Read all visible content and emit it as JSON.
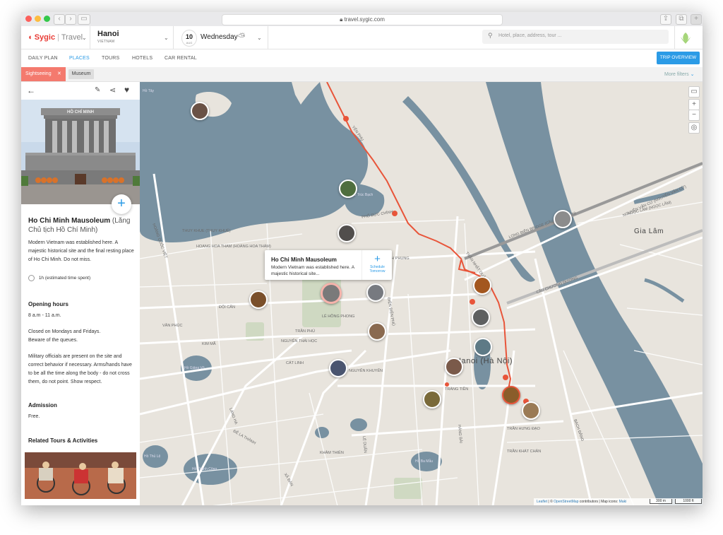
{
  "browser": {
    "url": "travel.sygic.com"
  },
  "header": {
    "logo_brand": "Sygic",
    "logo_product": "Travel",
    "city": "Hanoi",
    "country": "VIETNAM",
    "date_day": "10",
    "date_month": "AUG",
    "weekday": "Wednesday",
    "search_placeholder": "Hotel, place, address, tour ..."
  },
  "tabs": [
    {
      "label": "DAILY PLAN"
    },
    {
      "label": "PLACES"
    },
    {
      "label": "TOURS"
    },
    {
      "label": "HOTELS"
    },
    {
      "label": "CAR RENTAL"
    }
  ],
  "trip_overview_label": "TRIP OVERVIEW",
  "filters": {
    "active": "Sightseeing",
    "secondary": "Museum",
    "more": "More filters"
  },
  "place": {
    "name": "Ho Chi Minh Mausoleum",
    "local_name": "(Lăng Chủ tịch Hồ Chí Minh)",
    "image_sign": "HỒ CHÍ MINH",
    "description": "Modern Vietnam was established here. A majestic historical site and the final resting place of Ho Chi Minh. Do not miss.",
    "duration": "1h (estimated time spent)",
    "opening_heading": "Opening hours",
    "opening_hours": "8 a.m - 11 a.m.",
    "closed_note_1": "Closed on Mondays and Fridays.",
    "closed_note_2": "Beware of the queues.",
    "military_note": "Military officials are present on the site and correct behavior if necessary. Arms/hands have to be all the time along the body - do not cross them, do not point. Show respect.",
    "admission_heading": "Admission",
    "admission": "Free.",
    "related_heading": "Related Tours & Activities"
  },
  "popup": {
    "title": "Ho Chi Minh Mausoleum",
    "desc": "Modern Vietnam was established here. A majestic historical site...",
    "schedule_line1": "Schedule",
    "schedule_line2": "Tomorrow"
  },
  "map": {
    "city_label": "Hanoi (Hà Nội)",
    "district_label": "Gia Lâm",
    "lake_labels": [
      "Hồ Tây",
      "Hồ Trúc Bạch",
      "Hồ Giảng Võ",
      "Hồ Thành Công",
      "Hồ Thủ Lệ",
      "Hồ Ba Mẫu"
    ],
    "street_labels": [
      "THUY KHUE (THỤY KHUÊ)",
      "HOANG HOA THAM (HOÀNG HOA THÁM)",
      "PHAN DINH PHUNG",
      "ĐỘI CẤN",
      "LÊ HỒNG PHONG",
      "ĐIỆN BIÊN PHỦ",
      "TRẦN PHÚ",
      "NGUYỄN THÁI HỌC",
      "KIM MÃ",
      "CÁT LINH",
      "GIẢNG VÕ",
      "NGUYỄN KHUYẾN",
      "LÊ DUẨN",
      "HÀNG BÀI",
      "TRÀNG TIỀN",
      "TRẦN HƯNG ĐẠO",
      "TRẦN NHẬT DUẬT",
      "YÊN PHỤ",
      "LONG BIÊN BRIDGE (CẦU LONG BIÊN)",
      "CẦU CHƯƠNG DƯƠNG",
      "NGỌC LÂM (NGỌC LÂM)",
      "NGUYỄN VĂN CỪ (NGUYỄN VĂN CỪ)",
      "XÃ ĐÀN",
      "LÁNG HẠ",
      "ĐÊ LA THÀNH",
      "KHÂM THIÊN",
      "TRẦN KHÁT CHÂN",
      "BẠCH ĐẰNG",
      "HOÀNG QUỐC VIỆT",
      "ĐỘI CẤN",
      "VĂN PHÚC",
      "PHỐ ĐỨC CHÍNH"
    ],
    "attribution_leaflet": "Leaflet",
    "attribution_osm": "OpenStreetMap",
    "attribution_rest": "contributors | Map icons:",
    "attribution_maki": "Maki",
    "scale_m": "300 m",
    "scale_ft": "1000 ft"
  },
  "colors": {
    "accent": "#2b9be6",
    "sightseeing": "#f47a6e",
    "route": "#e8553a",
    "water": "#7891a1",
    "land": "#e8e4dd"
  }
}
